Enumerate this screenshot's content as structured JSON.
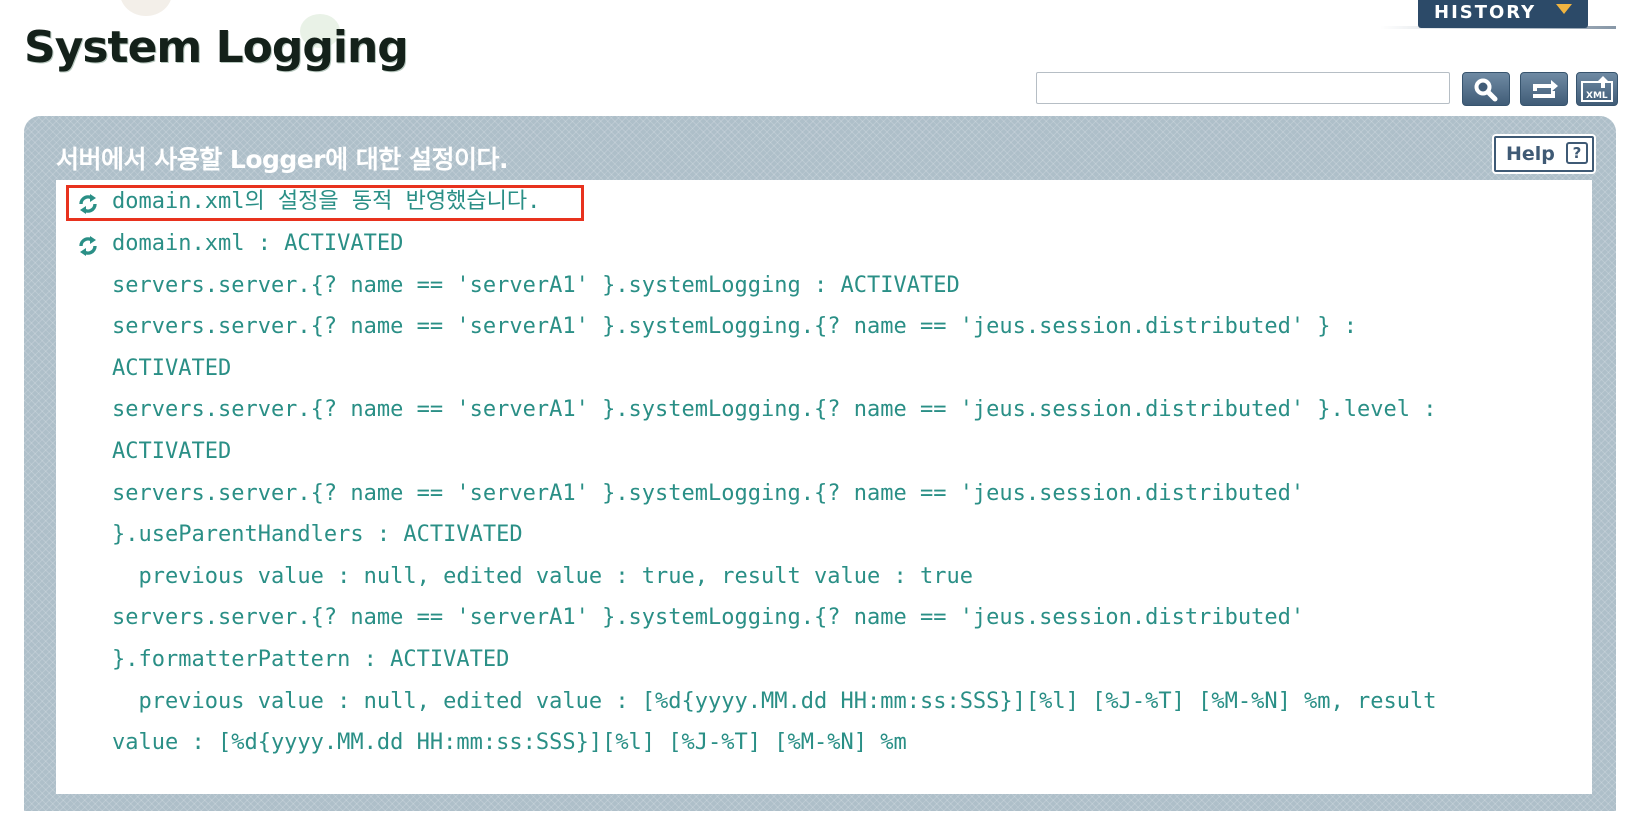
{
  "page_title": "System Logging",
  "history_tab": {
    "label": "HISTORY",
    "arrow_color": "#f0b440"
  },
  "search": {
    "value": "",
    "placeholder": ""
  },
  "toolbar": {
    "search_icon": "magnifier-icon",
    "refresh_icon": "refresh-icon",
    "xml_icon": "xml-export-icon",
    "xml_label": "XML"
  },
  "panel": {
    "description": "서버에서 사용할 Logger에 대한 설정이다.",
    "help_label": "Help",
    "help_icon_text": "?"
  },
  "messages": {
    "applied": "domain.xml의 설정을 동적 반영했습니다.",
    "lines": [
      "domain.xml : ACTIVATED",
      "servers.server.{? name == 'serverA1' }.systemLogging : ACTIVATED",
      "servers.server.{? name == 'serverA1' }.systemLogging.{? name == 'jeus.session.distributed' } :",
      "ACTIVATED",
      "servers.server.{? name == 'serverA1' }.systemLogging.{? name == 'jeus.session.distributed' }.level :",
      "ACTIVATED",
      "servers.server.{? name == 'serverA1' }.systemLogging.{? name == 'jeus.session.distributed'",
      "}.useParentHandlers : ACTIVATED",
      "  previous value : null, edited value : true, result value : true",
      "servers.server.{? name == 'serverA1' }.systemLogging.{? name == 'jeus.session.distributed'",
      "}.formatterPattern : ACTIVATED",
      "  previous value : null, edited value : [%d{yyyy.MM.dd HH:mm:ss:SSS}][%l] [%J-%T] [%M-%N] %m, result",
      "value : [%d{yyyy.MM.dd HH:mm:ss:SSS}][%l] [%J-%T] [%M-%N] %m"
    ]
  },
  "colors": {
    "message_text": "#2a8f86",
    "highlight_border": "#e8321e",
    "panel_bg": "#aebfc9",
    "button_bg": "#405c77"
  }
}
